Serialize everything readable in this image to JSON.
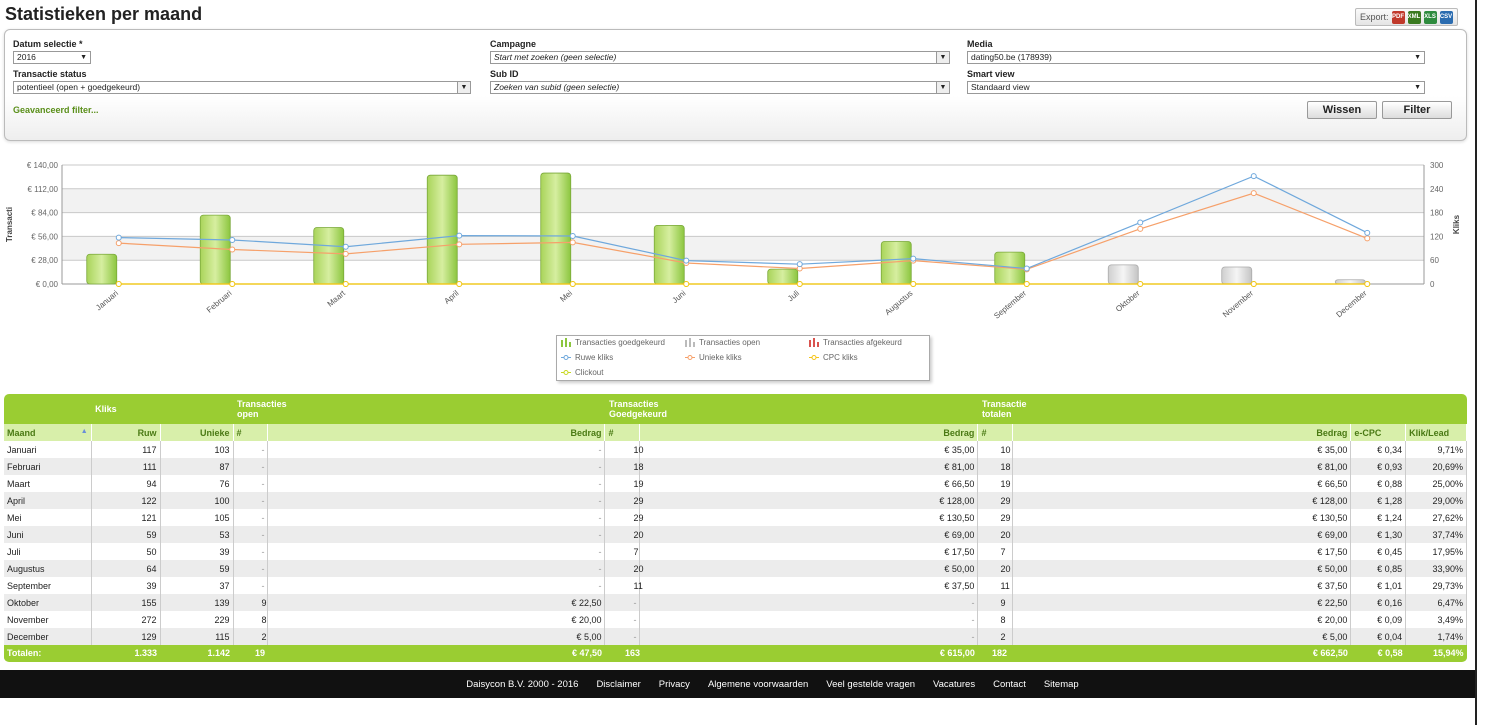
{
  "page": {
    "title": "Statistieken per maand",
    "export_label": "Export:"
  },
  "export_icons": [
    {
      "name": "pdf",
      "label": "PDF",
      "color": "#c0392b"
    },
    {
      "name": "xml",
      "label": "XML",
      "color": "#3a7a20"
    },
    {
      "name": "xls",
      "label": "XLS",
      "color": "#2e8b3e"
    },
    {
      "name": "csv",
      "label": "CSV",
      "color": "#2b6cb0"
    }
  ],
  "filters": {
    "datum_label": "Datum selectie *",
    "datum_value": "2016",
    "campagne_label": "Campagne",
    "campagne_value": "Start met zoeken (geen selectie)",
    "media_label": "Media",
    "media_value": "dating50.be (178939)",
    "status_label": "Transactie status",
    "status_value": "potentieel (open + goedgekeurd)",
    "subid_label": "Sub ID",
    "subid_value": "Zoeken van subid (geen selectie)",
    "smart_label": "Smart view",
    "smart_value": "Standaard view",
    "advanced_link": "Geavanceerd filter...",
    "wissen_button": "Wissen",
    "filter_button": "Filter"
  },
  "chart_data": {
    "type": "bar",
    "categories": [
      "Januari",
      "Februari",
      "Maart",
      "April",
      "Mei",
      "Juni",
      "Juli",
      "Augustus",
      "September",
      "Oktober",
      "November",
      "December"
    ],
    "ylabel": "Transacti",
    "y2label": "Kliks",
    "y_ticks": [
      "€ 0,00",
      "€ 28,00",
      "€ 56,00",
      "€ 84,00",
      "€ 112,00",
      "€ 140,00"
    ],
    "ylim": [
      0,
      140
    ],
    "y2_ticks": [
      "0",
      "60",
      "120",
      "180",
      "240",
      "300"
    ],
    "y2lim": [
      0,
      300
    ],
    "grid": true,
    "legend_position": "bottom",
    "series": [
      {
        "name": "Transacties goedgekeurd",
        "kind": "bar",
        "axis": "left",
        "color": "#8cc63f",
        "values": [
          35.0,
          81.0,
          66.5,
          128.0,
          130.5,
          69.0,
          17.5,
          50.0,
          37.5,
          0,
          0,
          0
        ]
      },
      {
        "name": "Transacties open",
        "kind": "bar",
        "axis": "left",
        "color": "#d0d0d0",
        "values": [
          0,
          0,
          0,
          0,
          0,
          0,
          0,
          0,
          0,
          22.5,
          20.0,
          5.0
        ]
      },
      {
        "name": "Transacties afgekeurd",
        "kind": "bar",
        "axis": "left",
        "color": "#d9534f",
        "values": [
          0,
          0,
          0,
          0,
          0,
          0,
          0,
          0,
          0,
          0,
          0,
          0
        ]
      },
      {
        "name": "Ruwe kliks",
        "kind": "line",
        "axis": "right",
        "color": "#6fa8dc",
        "values": [
          117,
          111,
          94,
          122,
          121,
          59,
          50,
          64,
          39,
          155,
          272,
          129
        ]
      },
      {
        "name": "Unieke kliks",
        "kind": "line",
        "axis": "right",
        "color": "#f6a06a",
        "values": [
          103,
          87,
          76,
          100,
          105,
          53,
          39,
          59,
          37,
          139,
          229,
          115
        ]
      },
      {
        "name": "CPC kliks",
        "kind": "line",
        "axis": "right",
        "color": "#f5c518",
        "values": [
          0,
          0,
          0,
          0,
          0,
          0,
          0,
          0,
          0,
          0,
          0,
          0
        ]
      },
      {
        "name": "Clickout",
        "kind": "line",
        "axis": "right",
        "color": "#c8d820",
        "values": [
          0,
          0,
          0,
          0,
          0,
          0,
          0,
          0,
          0,
          0,
          0,
          0
        ]
      }
    ]
  },
  "table": {
    "group_headers": {
      "kliks": "Kliks",
      "open": "Transacties open",
      "goed": "Transacties Goedgekeurd",
      "totalen": "Transactie totalen"
    },
    "columns": {
      "maand": "Maand",
      "ruw": "Ruw",
      "unieke": "Unieke",
      "hash": "#",
      "bedrag": "Bedrag",
      "ecpc": "e-CPC",
      "kliklead": "Klik/Lead"
    },
    "rows": [
      {
        "maand": "Januari",
        "ruw": "117",
        "unieke": "103",
        "o_n": "-",
        "o_b": "-",
        "g_n": "10",
        "g_b": "€ 35,00",
        "t_n": "10",
        "t_b": "€ 35,00",
        "ecpc": "€ 0,34",
        "kl": "9,71%"
      },
      {
        "maand": "Februari",
        "ruw": "111",
        "unieke": "87",
        "o_n": "-",
        "o_b": "-",
        "g_n": "18",
        "g_b": "€ 81,00",
        "t_n": "18",
        "t_b": "€ 81,00",
        "ecpc": "€ 0,93",
        "kl": "20,69%"
      },
      {
        "maand": "Maart",
        "ruw": "94",
        "unieke": "76",
        "o_n": "-",
        "o_b": "-",
        "g_n": "19",
        "g_b": "€ 66,50",
        "t_n": "19",
        "t_b": "€ 66,50",
        "ecpc": "€ 0,88",
        "kl": "25,00%"
      },
      {
        "maand": "April",
        "ruw": "122",
        "unieke": "100",
        "o_n": "-",
        "o_b": "-",
        "g_n": "29",
        "g_b": "€ 128,00",
        "t_n": "29",
        "t_b": "€ 128,00",
        "ecpc": "€ 1,28",
        "kl": "29,00%"
      },
      {
        "maand": "Mei",
        "ruw": "121",
        "unieke": "105",
        "o_n": "-",
        "o_b": "-",
        "g_n": "29",
        "g_b": "€ 130,50",
        "t_n": "29",
        "t_b": "€ 130,50",
        "ecpc": "€ 1,24",
        "kl": "27,62%"
      },
      {
        "maand": "Juni",
        "ruw": "59",
        "unieke": "53",
        "o_n": "-",
        "o_b": "-",
        "g_n": "20",
        "g_b": "€ 69,00",
        "t_n": "20",
        "t_b": "€ 69,00",
        "ecpc": "€ 1,30",
        "kl": "37,74%"
      },
      {
        "maand": "Juli",
        "ruw": "50",
        "unieke": "39",
        "o_n": "-",
        "o_b": "-",
        "g_n": "7",
        "g_b": "€ 17,50",
        "t_n": "7",
        "t_b": "€ 17,50",
        "ecpc": "€ 0,45",
        "kl": "17,95%"
      },
      {
        "maand": "Augustus",
        "ruw": "64",
        "unieke": "59",
        "o_n": "-",
        "o_b": "-",
        "g_n": "20",
        "g_b": "€ 50,00",
        "t_n": "20",
        "t_b": "€ 50,00",
        "ecpc": "€ 0,85",
        "kl": "33,90%"
      },
      {
        "maand": "September",
        "ruw": "39",
        "unieke": "37",
        "o_n": "-",
        "o_b": "-",
        "g_n": "11",
        "g_b": "€ 37,50",
        "t_n": "11",
        "t_b": "€ 37,50",
        "ecpc": "€ 1,01",
        "kl": "29,73%"
      },
      {
        "maand": "Oktober",
        "ruw": "155",
        "unieke": "139",
        "o_n": "9",
        "o_b": "€ 22,50",
        "g_n": "-",
        "g_b": "-",
        "t_n": "9",
        "t_b": "€ 22,50",
        "ecpc": "€ 0,16",
        "kl": "6,47%"
      },
      {
        "maand": "November",
        "ruw": "272",
        "unieke": "229",
        "o_n": "8",
        "o_b": "€ 20,00",
        "g_n": "-",
        "g_b": "-",
        "t_n": "8",
        "t_b": "€ 20,00",
        "ecpc": "€ 0,09",
        "kl": "3,49%"
      },
      {
        "maand": "December",
        "ruw": "129",
        "unieke": "115",
        "o_n": "2",
        "o_b": "€ 5,00",
        "g_n": "-",
        "g_b": "-",
        "t_n": "2",
        "t_b": "€ 5,00",
        "ecpc": "€ 0,04",
        "kl": "1,74%"
      }
    ],
    "totals": {
      "label": "Totalen:",
      "ruw": "1.333",
      "unieke": "1.142",
      "o_n": "19",
      "o_b": "€ 47,50",
      "g_n": "163",
      "g_b": "€ 615,00",
      "t_n": "182",
      "t_b": "€ 662,50",
      "ecpc": "€ 0,58",
      "kl": "15,94%"
    }
  },
  "footer": {
    "copyright": "Daisycon B.V. 2000 - 2016",
    "links": [
      "Disclaimer",
      "Privacy",
      "Algemene voorwaarden",
      "Veel gestelde vragen",
      "Vacatures",
      "Contact",
      "Sitemap"
    ]
  }
}
